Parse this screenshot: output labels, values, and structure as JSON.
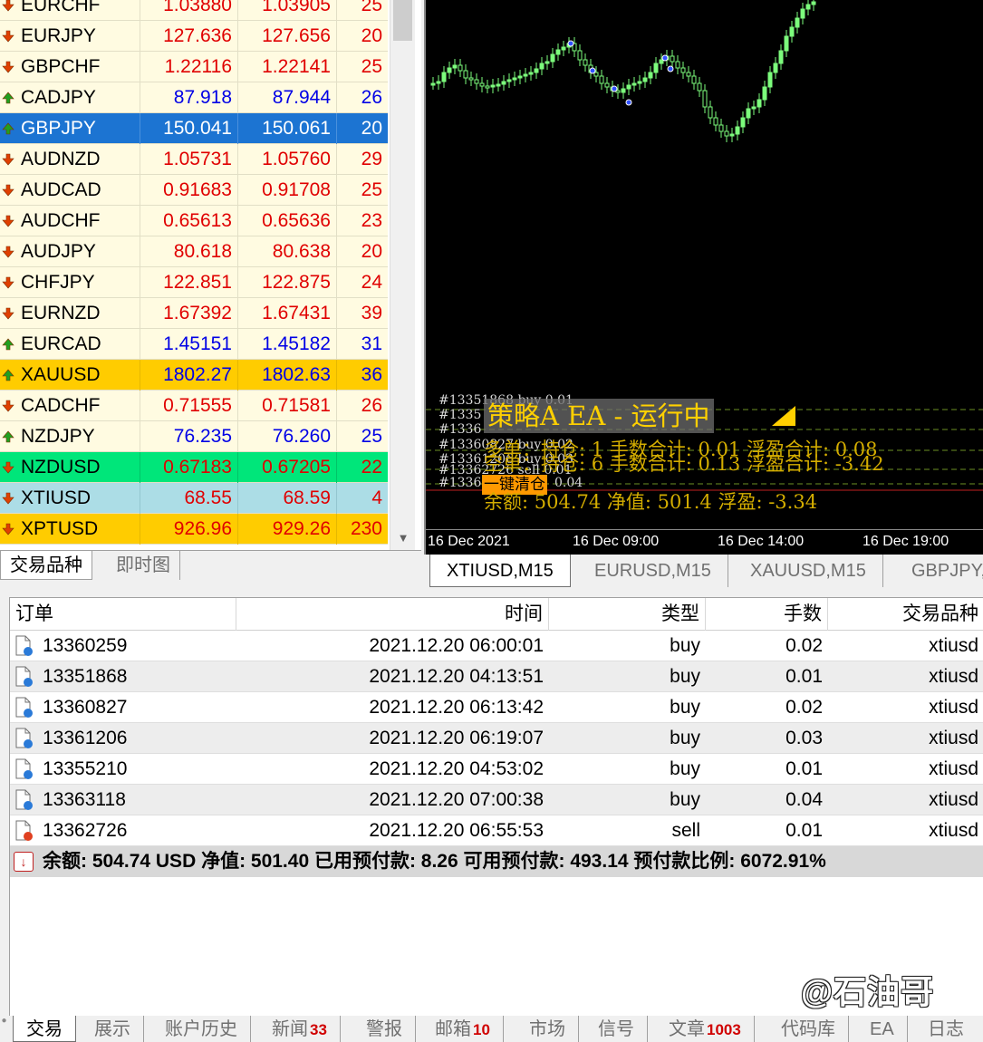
{
  "market_watch": {
    "rows": [
      {
        "symbol": "EURCHF",
        "bid": "1.03880",
        "ask": "1.03905",
        "spread": "25",
        "dir": "down",
        "style": "",
        "color": "red"
      },
      {
        "symbol": "EURJPY",
        "bid": "127.636",
        "ask": "127.656",
        "spread": "20",
        "dir": "down",
        "style": "",
        "color": "red"
      },
      {
        "symbol": "GBPCHF",
        "bid": "1.22116",
        "ask": "1.22141",
        "spread": "25",
        "dir": "down",
        "style": "",
        "color": "red"
      },
      {
        "symbol": "CADJPY",
        "bid": "87.918",
        "ask": "87.944",
        "spread": "26",
        "dir": "up",
        "style": "",
        "color": "blue"
      },
      {
        "symbol": "GBPJPY",
        "bid": "150.041",
        "ask": "150.061",
        "spread": "20",
        "dir": "up",
        "style": "sel",
        "color": "white"
      },
      {
        "symbol": "AUDNZD",
        "bid": "1.05731",
        "ask": "1.05760",
        "spread": "29",
        "dir": "down",
        "style": "",
        "color": "red"
      },
      {
        "symbol": "AUDCAD",
        "bid": "0.91683",
        "ask": "0.91708",
        "spread": "25",
        "dir": "down",
        "style": "",
        "color": "red"
      },
      {
        "symbol": "AUDCHF",
        "bid": "0.65613",
        "ask": "0.65636",
        "spread": "23",
        "dir": "down",
        "style": "",
        "color": "red"
      },
      {
        "symbol": "AUDJPY",
        "bid": "80.618",
        "ask": "80.638",
        "spread": "20",
        "dir": "down",
        "style": "",
        "color": "red"
      },
      {
        "symbol": "CHFJPY",
        "bid": "122.851",
        "ask": "122.875",
        "spread": "24",
        "dir": "down",
        "style": "",
        "color": "red"
      },
      {
        "symbol": "EURNZD",
        "bid": "1.67392",
        "ask": "1.67431",
        "spread": "39",
        "dir": "down",
        "style": "",
        "color": "red"
      },
      {
        "symbol": "EURCAD",
        "bid": "1.45151",
        "ask": "1.45182",
        "spread": "31",
        "dir": "up",
        "style": "",
        "color": "blue"
      },
      {
        "symbol": "XAUUSD",
        "bid": "1802.27",
        "ask": "1802.63",
        "spread": "36",
        "dir": "up",
        "style": "gold",
        "color": "blue"
      },
      {
        "symbol": "CADCHF",
        "bid": "0.71555",
        "ask": "0.71581",
        "spread": "26",
        "dir": "down",
        "style": "",
        "color": "red"
      },
      {
        "symbol": "NZDJPY",
        "bid": "76.235",
        "ask": "76.260",
        "spread": "25",
        "dir": "up",
        "style": "",
        "color": "blue"
      },
      {
        "symbol": "NZDUSD",
        "bid": "0.67183",
        "ask": "0.67205",
        "spread": "22",
        "dir": "down",
        "style": "green",
        "color": "red"
      },
      {
        "symbol": "XTIUSD",
        "bid": "68.55",
        "ask": "68.59",
        "spread": "4",
        "dir": "down",
        "style": "cyan",
        "color": "red"
      },
      {
        "symbol": "XPTUSD",
        "bid": "926.96",
        "ask": "929.26",
        "spread": "230",
        "dir": "down",
        "style": "gold",
        "color": "red"
      }
    ],
    "tabs": {
      "symbols": "交易品种",
      "tick": "即时图"
    }
  },
  "chart": {
    "order_labels": [
      "#13351868 buy 0.01",
      "#1335",
      "#1336",
      "#13360827 buy 0.02",
      "#13361206 buy 0.03",
      "#13362726 sell 0.01",
      "#1336",
      "0.04"
    ],
    "ea_panel": {
      "title": "策略A  EA - 运行中",
      "line1": "多单：持仓: 1  手数合计: 0.01  浮盈合计: 0.08",
      "line2": "空单：持仓: 6  手数合计: 0.13  浮盈合计: -3.42",
      "close_button": "一键清仓",
      "line3": "余额: 504.74   净值: 501.4   浮盈: -3.34"
    },
    "time_labels": [
      "16 Dec 2021",
      "16 Dec 09:00",
      "16 Dec 14:00",
      "16 Dec 19:00"
    ],
    "colors": {
      "candle": "#7cfc7c",
      "ea_text": "#ffd000",
      "grid": "#6b8f23"
    }
  },
  "chart_tabs": [
    "XTIUSD,M15",
    "EURUSD,M15",
    "XAUUSD,M15",
    "GBPJPY,"
  ],
  "terminal": {
    "headers": {
      "order": "订单",
      "time": "时间",
      "type": "类型",
      "lots": "手数",
      "symbol": "交易品种"
    },
    "rows": [
      {
        "order": "13360259",
        "time": "2021.12.20 06:00:01",
        "type": "buy",
        "lots": "0.02",
        "symbol": "xtiusd",
        "kind": "buy"
      },
      {
        "order": "13351868",
        "time": "2021.12.20 04:13:51",
        "type": "buy",
        "lots": "0.01",
        "symbol": "xtiusd",
        "kind": "buy"
      },
      {
        "order": "13360827",
        "time": "2021.12.20 06:13:42",
        "type": "buy",
        "lots": "0.02",
        "symbol": "xtiusd",
        "kind": "buy"
      },
      {
        "order": "13361206",
        "time": "2021.12.20 06:19:07",
        "type": "buy",
        "lots": "0.03",
        "symbol": "xtiusd",
        "kind": "buy"
      },
      {
        "order": "13355210",
        "time": "2021.12.20 04:53:02",
        "type": "buy",
        "lots": "0.01",
        "symbol": "xtiusd",
        "kind": "buy"
      },
      {
        "order": "13363118",
        "time": "2021.12.20 07:00:38",
        "type": "buy",
        "lots": "0.04",
        "symbol": "xtiusd",
        "kind": "buy"
      },
      {
        "order": "13362726",
        "time": "2021.12.20 06:55:53",
        "type": "sell",
        "lots": "0.01",
        "symbol": "xtiusd",
        "kind": "sell"
      }
    ],
    "summary": "余额: 504.74 USD  净值: 501.40  已用预付款: 8.26  可用预付款: 493.14  预付款比例: 6072.91%"
  },
  "watermark": "@石油哥",
  "bottom_tabs": [
    {
      "label": "交易",
      "badge": ""
    },
    {
      "label": "展示",
      "badge": ""
    },
    {
      "label": "账户历史",
      "badge": ""
    },
    {
      "label": "新闻",
      "badge": "33"
    },
    {
      "label": "警报",
      "badge": ""
    },
    {
      "label": "邮箱",
      "badge": "10"
    },
    {
      "label": "市场",
      "badge": ""
    },
    {
      "label": "信号",
      "badge": ""
    },
    {
      "label": "文章",
      "badge": "1003"
    },
    {
      "label": "代码库",
      "badge": ""
    },
    {
      "label": "EA",
      "badge": ""
    },
    {
      "label": "日志",
      "badge": ""
    }
  ]
}
